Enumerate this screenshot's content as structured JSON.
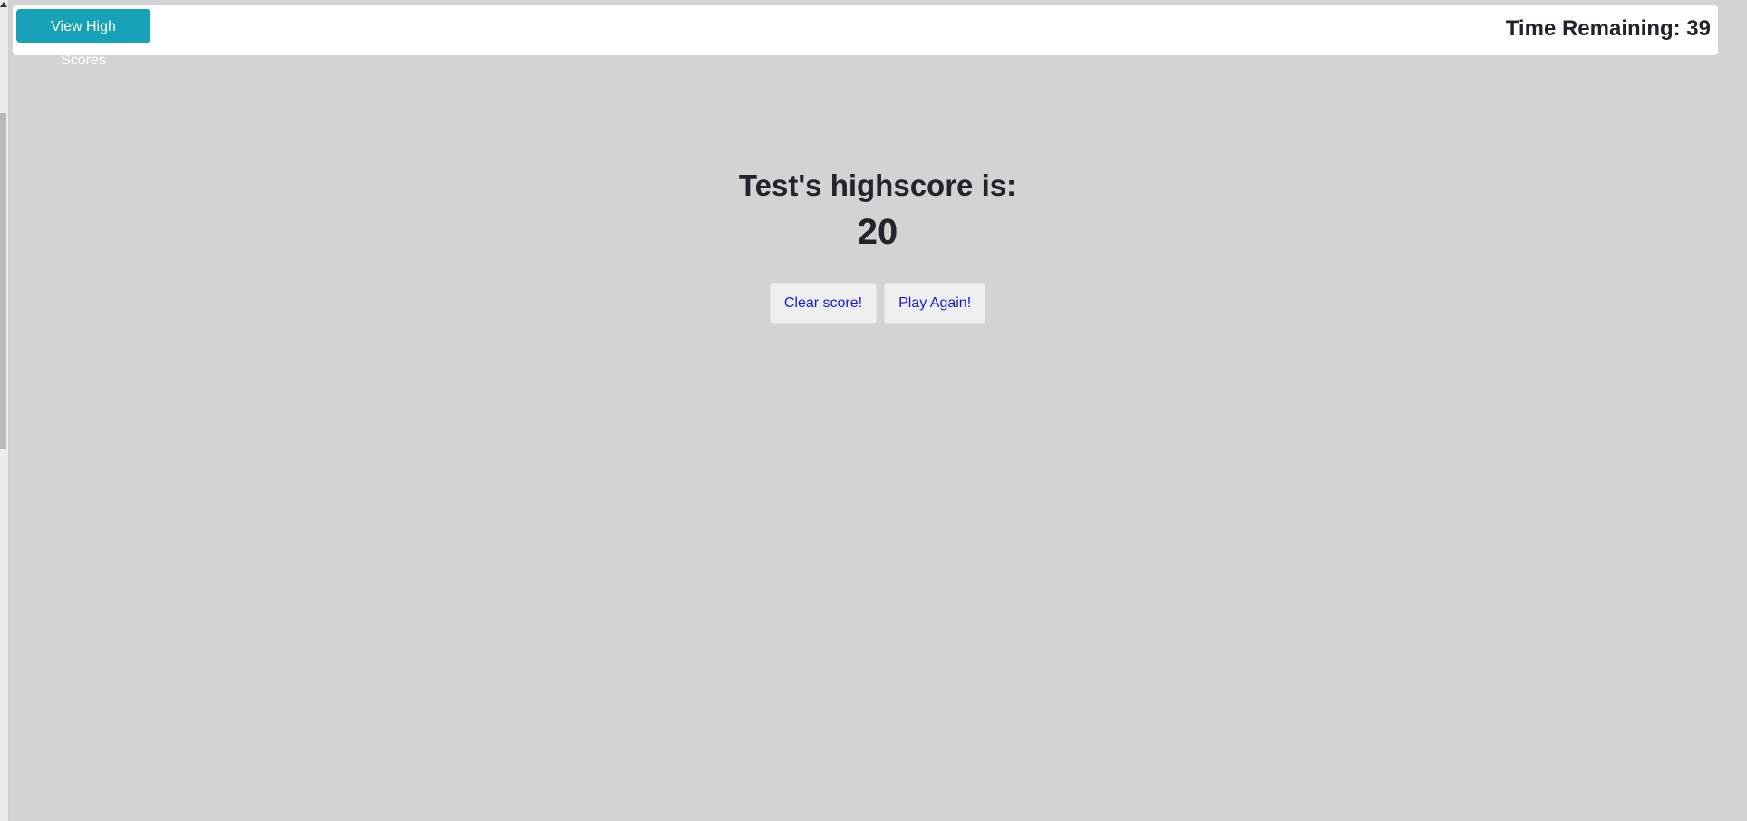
{
  "header": {
    "view_high_scores_label": "View High Scores",
    "timer_label": "Time Remaining: 39",
    "accent_color": "#17a2b8"
  },
  "score": {
    "title": "Test's highscore is:",
    "value": "20"
  },
  "actions": {
    "clear_label": "Clear score!",
    "play_again_label": "Play Again!"
  },
  "colors": {
    "background": "#d3d3d3",
    "link_text": "#1a1ad6"
  }
}
